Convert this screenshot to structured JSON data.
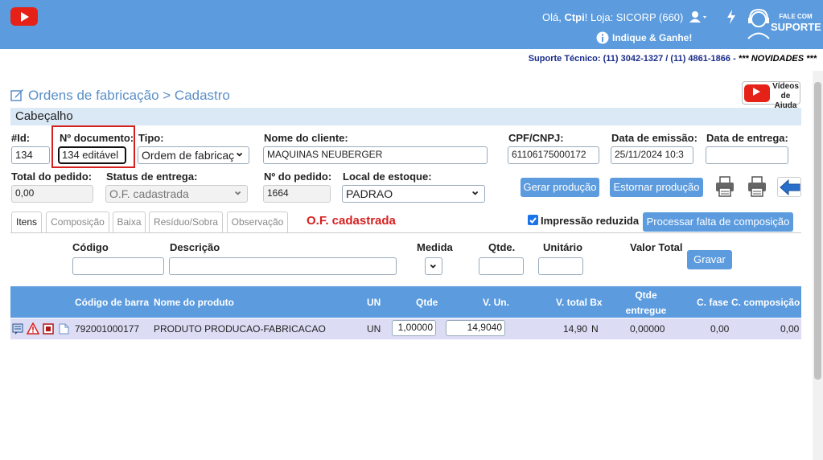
{
  "header": {
    "greeting_prefix": "Olá, ",
    "user": "Ctpi",
    "greeting_suffix": "!",
    "store": "Loja: SICORP (660)",
    "refer": "Indique & Ganhe!",
    "support_top": "FALE COM",
    "support_main": "SUPORTE"
  },
  "support_line": {
    "text": "Suporte Técnico: (11) 3042-1327 / (11) 4861-1866 - ",
    "news": "*** NOVIDADES ***"
  },
  "page": {
    "title": "Ordens de fabricação > Cadastro",
    "video_help_1": "Vídeos",
    "video_help_2": "de Ajuda",
    "youtube": "YouTube"
  },
  "section": {
    "title": "Cabeçalho"
  },
  "form": {
    "id_label": "#Id:",
    "id_value": "134",
    "doc_label": "Nº documento:",
    "doc_value": "134 editável",
    "tipo_label": "Tipo:",
    "tipo_value": "Ordem de fabricaç",
    "cliente_label": "Nome do cliente:",
    "cliente_value": "MAQUINAS NEUBERGER",
    "cpf_label": "CPF/CNPJ:",
    "cpf_value": "61106175000172",
    "emissao_label": "Data de emissão:",
    "emissao_value": "25/11/2024 10:3",
    "entrega_label": "Data de entrega:",
    "entrega_value": "",
    "total_label": "Total do pedido:",
    "total_value": "0,00",
    "status_label": "Status de entrega:",
    "status_value": "O.F. cadastrada",
    "pedido_label": "Nº do pedido:",
    "pedido_value": "1664",
    "local_label": "Local de estoque:",
    "local_value": "PADRAO"
  },
  "buttons": {
    "gerar": "Gerar produção",
    "estornar": "Estornar produção",
    "processar": "Processar falta de composição",
    "gravar": "Gravar"
  },
  "tabs": [
    "Itens",
    "Composição",
    "Baixa",
    "Resíduo/Sobra",
    "Observação"
  ],
  "status_text": "O.F. cadastrada",
  "reduced_print": "Impressão reduzida",
  "item_form": {
    "codigo": "Código",
    "descricao": "Descrição",
    "medida": "Medida",
    "qtde": "Qtde.",
    "unitario": "Unitário",
    "valor_total": "Valor Total"
  },
  "grid": {
    "headers": {
      "barcode": "Código de barra",
      "produto": "Nome do produto",
      "un": "UN",
      "qtde": "Qtde",
      "vun": "V. Un.",
      "vtotal": "V. total Bx",
      "qtde_entregue_1": "Qtde",
      "qtde_entregue_2": "entregue",
      "cfase": "C. fase",
      "ccomp": "C. composição"
    },
    "row": {
      "barcode": "792001000177",
      "produto": "PRODUTO PRODUCAO-FABRICACAO",
      "un": "UN",
      "qtde": "1,00000",
      "vun": "14,9040",
      "vtotal": "14,90",
      "flag": "N",
      "qtde_entregue": "0,00000",
      "cfase": "0,00",
      "ccomp": "0,00"
    }
  },
  "colors": {
    "accent": "#5b9bde",
    "status_red": "#d62020",
    "highlight_box": "#d62020"
  }
}
